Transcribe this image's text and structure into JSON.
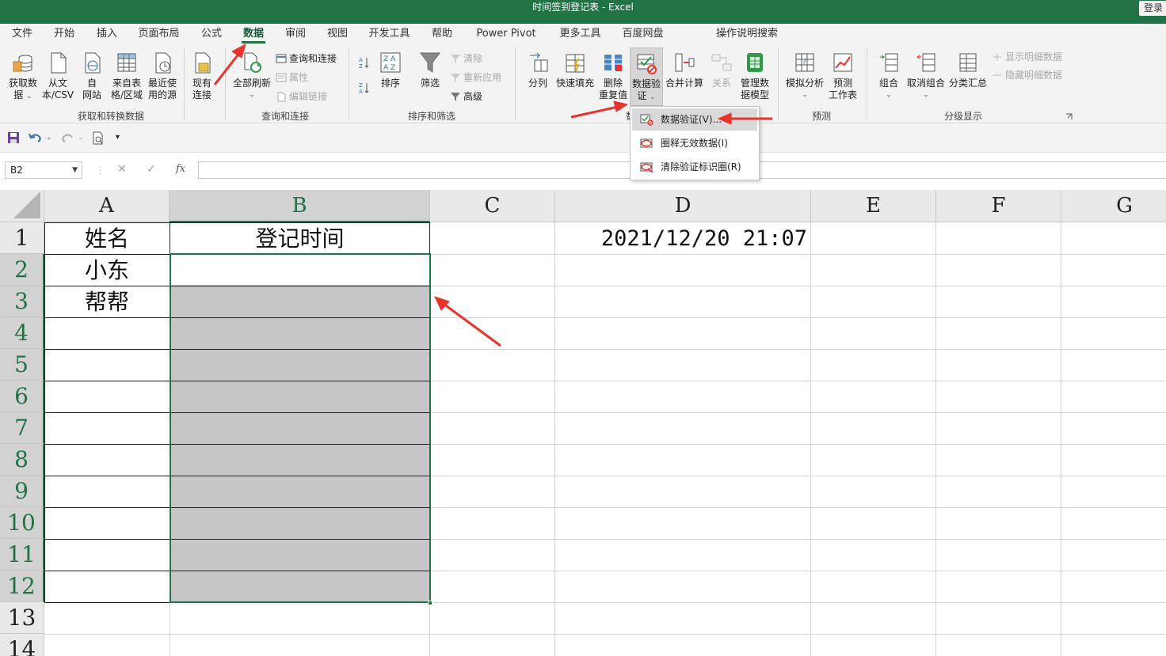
{
  "window": {
    "title": "时间签到登记表  -  Excel",
    "login_label": "登录"
  },
  "menu": {
    "tabs": [
      "文件",
      "开始",
      "插入",
      "页面布局",
      "公式",
      "数据",
      "审阅",
      "视图",
      "开发工具",
      "帮助",
      "Power Pivot",
      "更多工具",
      "百度网盘"
    ],
    "active_tab": "数据",
    "tell_me": "操作说明搜索"
  },
  "ribbon": {
    "get_data": {
      "line1": "获取数",
      "line2": "据",
      "caret": "⌄"
    },
    "from_text": {
      "line1": "从文",
      "line2": "本/CSV"
    },
    "from_web": {
      "line1": "自",
      "line2": "网站"
    },
    "from_table": {
      "line1": "来自表",
      "line2": "格/区域"
    },
    "recent_sources": {
      "line1": "最近使",
      "line2": "用的源"
    },
    "existing_conn": {
      "line1": "现有",
      "line2": "连接"
    },
    "group_get_transform": "获取和转换数据",
    "refresh_all": {
      "line1": "全部刷新",
      "caret": "⌄"
    },
    "queries_conn": "查询和连接",
    "properties": "属性",
    "edit_links": "编辑链接",
    "group_queries": "查询和连接",
    "sort": "排序",
    "filter": "筛选",
    "clear": "清除",
    "reapply": "重新应用",
    "advanced": "高级",
    "group_sort_filter": "排序和筛选",
    "text_to_columns": "分列",
    "flash_fill": "快速填充",
    "remove_duplicates": {
      "line1": "删除",
      "line2": "重复值"
    },
    "data_validation": {
      "line1": "数据验",
      "line2": "证",
      "caret": "⌄"
    },
    "consolidate": "合并计算",
    "relationships": "关系",
    "manage_model": {
      "line1": "管理数",
      "line2": "据模型"
    },
    "group_data_tools": "数",
    "what_if": {
      "line1": "模拟分析",
      "caret": "⌄"
    },
    "forecast_sheet": {
      "line1": "预测",
      "line2": "工作表"
    },
    "group_forecast": "预测",
    "group": {
      "line1": "组合",
      "caret": "⌄"
    },
    "ungroup": {
      "line1": "取消组合",
      "caret": "⌄"
    },
    "subtotal": "分类汇总",
    "show_detail": "显示明细数据",
    "hide_detail": "隐藏明细数据",
    "group_outline": "分级显示"
  },
  "dropdown": {
    "items": [
      "数据验证(V)...",
      "圈释无效数据(I)",
      "清除验证标识圈(R)"
    ]
  },
  "formula_bar": {
    "name_box": "B2",
    "fx": "fx",
    "cancel": "✕",
    "enter": "✓",
    "formula": ""
  },
  "sheet": {
    "columns": [
      "A",
      "B",
      "C",
      "D",
      "E",
      "F",
      "G"
    ],
    "rows": [
      "1",
      "2",
      "3",
      "4",
      "5",
      "6",
      "7",
      "8",
      "9",
      "10",
      "11",
      "12",
      "13",
      "14"
    ],
    "A1": "姓名",
    "B1": "登记时间",
    "A2": "小东",
    "A3": "帮帮",
    "D1": "2021/12/20 21:07",
    "selection": "B2:B12",
    "active_cell": "B2"
  },
  "colors": {
    "excel_green": "#217346",
    "arrow_red": "#e8322b",
    "selection_fill": "#c6c6c6"
  }
}
